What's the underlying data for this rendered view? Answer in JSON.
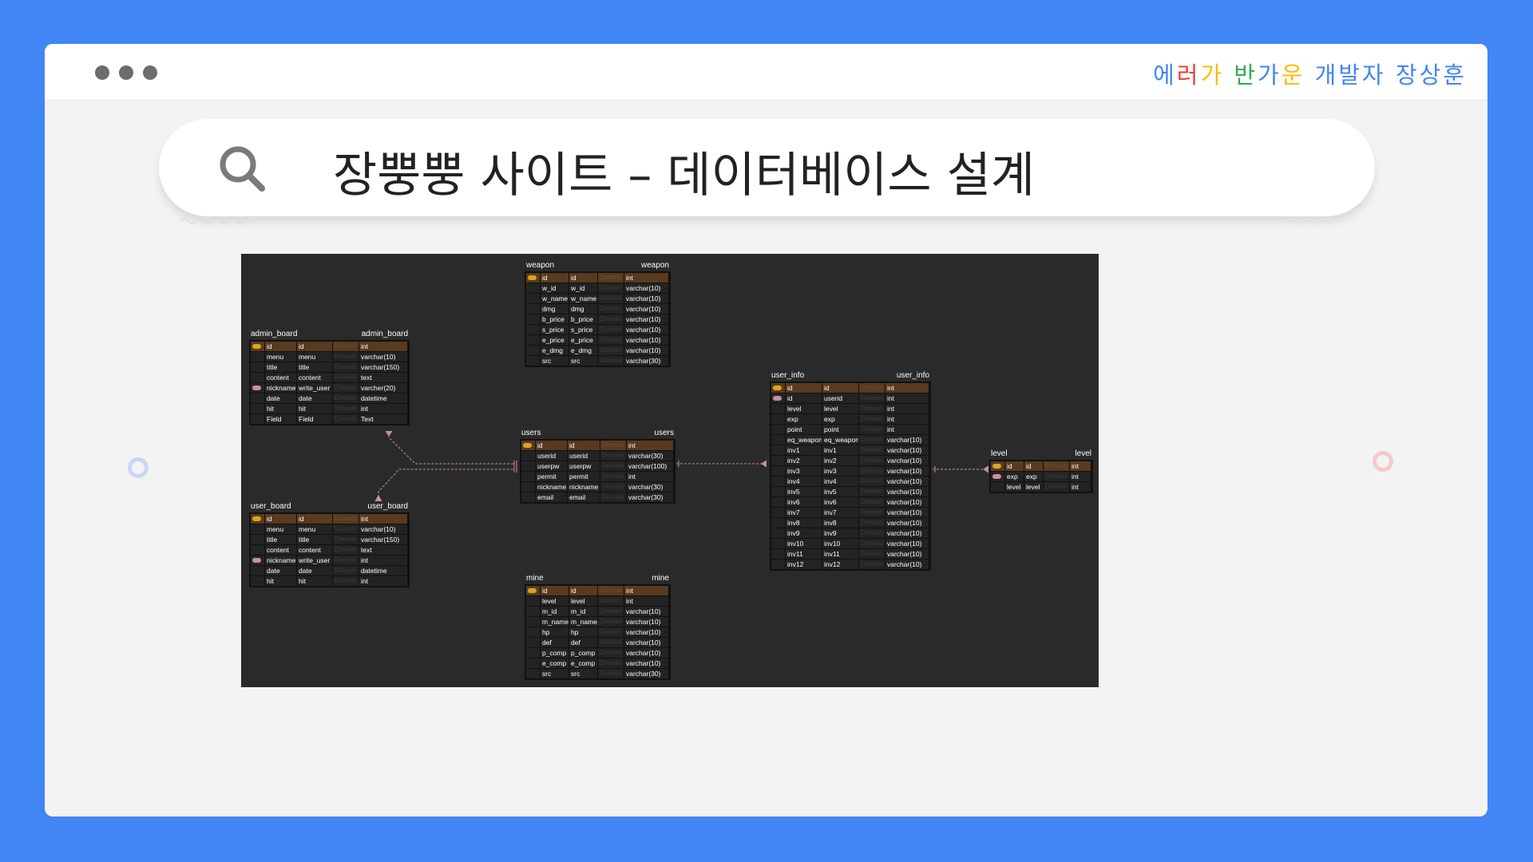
{
  "window": {
    "brand_chars": [
      {
        "ch": "에",
        "color": "#4285f4"
      },
      {
        "ch": "러",
        "color": "#ea4335"
      },
      {
        "ch": "가",
        "color": "#fbbc05"
      },
      {
        "ch": " ",
        "color": "#000000"
      },
      {
        "ch": "반",
        "color": "#34a853"
      },
      {
        "ch": "가",
        "color": "#4285f4"
      },
      {
        "ch": "운",
        "color": "#fbbc05"
      },
      {
        "ch": " ",
        "color": "#000000"
      },
      {
        "ch": "개",
        "color": "#4285f4"
      },
      {
        "ch": "발",
        "color": "#4285f4"
      },
      {
        "ch": "자",
        "color": "#4285f4"
      },
      {
        "ch": " ",
        "color": "#000000"
      },
      {
        "ch": "장",
        "color": "#4285f4"
      },
      {
        "ch": "상",
        "color": "#4285f4"
      },
      {
        "ch": "훈",
        "color": "#4285f4"
      }
    ]
  },
  "search": {
    "title": "장뿡뿡 사이트 – 데이터베이스 설계",
    "icon": "search-icon"
  },
  "tables": {
    "weapon": {
      "left": "weapon",
      "right": "weapon",
      "rows": [
        [
          "pk",
          "id",
          "id",
          "Domain",
          "int"
        ],
        [
          "",
          "w_id",
          "w_id",
          "Domain",
          "varchar(10)"
        ],
        [
          "",
          "w_name",
          "w_name",
          "Domain",
          "varchar(10)"
        ],
        [
          "",
          "dmg",
          "dmg",
          "Domain",
          "varchar(10)"
        ],
        [
          "",
          "b_price",
          "b_price",
          "Domain",
          "varchar(10)"
        ],
        [
          "",
          "s_price",
          "s_price",
          "Domain",
          "varchar(10)"
        ],
        [
          "",
          "e_price",
          "e_price",
          "Domain",
          "varchar(10)"
        ],
        [
          "",
          "e_dmg",
          "e_dmg",
          "Domain",
          "varchar(10)"
        ],
        [
          "",
          "src",
          "src",
          "Domain",
          "varchar(30)"
        ]
      ]
    },
    "admin_board": {
      "left": "admin_board",
      "right": "admin_board",
      "rows": [
        [
          "pk",
          "id",
          "id",
          "Domain",
          "int"
        ],
        [
          "",
          "menu",
          "menu",
          "Domain",
          "varchar(10)"
        ],
        [
          "",
          "title",
          "title",
          "Domain",
          "varchar(150)"
        ],
        [
          "",
          "content",
          "content",
          "Domain",
          "text"
        ],
        [
          "fk",
          "nickname",
          "write_user",
          "Domain",
          "varcher(20)"
        ],
        [
          "",
          "date",
          "date",
          "Domain",
          "datetime"
        ],
        [
          "",
          "hit",
          "hit",
          "Domain",
          "int"
        ],
        [
          "",
          "Field",
          "Field",
          "Domain",
          "Text"
        ]
      ]
    },
    "user_board": {
      "left": "user_board",
      "right": "user_board",
      "rows": [
        [
          "pk",
          "id",
          "id",
          "Domain",
          "int"
        ],
        [
          "",
          "menu",
          "menu",
          "Domain",
          "varchar(10)"
        ],
        [
          "",
          "title",
          "title",
          "Domain",
          "varchar(150)"
        ],
        [
          "",
          "content",
          "content",
          "Domain",
          "text"
        ],
        [
          "fk",
          "nickname",
          "write_user",
          "Domain",
          "int"
        ],
        [
          "",
          "date",
          "date",
          "Domain",
          "datetime"
        ],
        [
          "",
          "hit",
          "hit",
          "Domain",
          "int"
        ]
      ]
    },
    "users": {
      "left": "users",
      "right": "users",
      "rows": [
        [
          "pk",
          "id",
          "id",
          "Domain",
          "int"
        ],
        [
          "",
          "userid",
          "userid",
          "Domain",
          "varchar(30)"
        ],
        [
          "",
          "userpw",
          "userpw",
          "Domain",
          "varchar(100)"
        ],
        [
          "",
          "permit",
          "permit",
          "Domain",
          "int"
        ],
        [
          "",
          "nickname",
          "nickname",
          "Domain",
          "varchar(30)"
        ],
        [
          "",
          "email",
          "email",
          "Domain",
          "varchar(30)"
        ]
      ]
    },
    "mine": {
      "left": "mine",
      "right": "mine",
      "rows": [
        [
          "pk",
          "id",
          "id",
          "Domain",
          "int"
        ],
        [
          "",
          "level",
          "level",
          "Domain",
          "int"
        ],
        [
          "",
          "m_id",
          "m_id",
          "Domain",
          "varchar(10)"
        ],
        [
          "",
          "m_name",
          "m_name",
          "Domain",
          "varchar(10)"
        ],
        [
          "",
          "hp",
          "hp",
          "Domain",
          "varchar(10)"
        ],
        [
          "",
          "def",
          "def",
          "Domain",
          "varchar(10)"
        ],
        [
          "",
          "p_comp",
          "p_comp",
          "Domain",
          "varchar(10)"
        ],
        [
          "",
          "e_comp",
          "e_comp",
          "Domain",
          "varchar(10)"
        ],
        [
          "",
          "src",
          "src",
          "Domain",
          "varchar(30)"
        ]
      ]
    },
    "user_info": {
      "left": "user_info",
      "right": "user_info",
      "rows": [
        [
          "pk",
          "id",
          "id",
          "Domain",
          "int"
        ],
        [
          "fk",
          "id",
          "userid",
          "Domain",
          "int"
        ],
        [
          "",
          "level",
          "level",
          "Domain",
          "int"
        ],
        [
          "",
          "exp",
          "exp",
          "Domain",
          "int"
        ],
        [
          "",
          "point",
          "point",
          "Domain",
          "int"
        ],
        [
          "",
          "eq_weapon",
          "eq_weapon",
          "Domain",
          "varchar(10)"
        ],
        [
          "",
          "inv1",
          "inv1",
          "Domain",
          "varchar(10)"
        ],
        [
          "",
          "inv2",
          "inv2",
          "Domain",
          "varchar(10)"
        ],
        [
          "",
          "inv3",
          "inv3",
          "Domain",
          "varchar(10)"
        ],
        [
          "",
          "inv4",
          "inv4",
          "Domain",
          "varchar(10)"
        ],
        [
          "",
          "inv5",
          "inv5",
          "Domain",
          "varchar(10)"
        ],
        [
          "",
          "inv6",
          "inv6",
          "Domain",
          "varchar(10)"
        ],
        [
          "",
          "inv7",
          "inv7",
          "Domain",
          "varchar(10)"
        ],
        [
          "",
          "inv8",
          "inv8",
          "Domain",
          "varchar(10)"
        ],
        [
          "",
          "inv9",
          "inv9",
          "Domain",
          "varchar(10)"
        ],
        [
          "",
          "inv10",
          "inv10",
          "Domain",
          "varchar(10)"
        ],
        [
          "",
          "inv11",
          "inv11",
          "Domain",
          "varchar(10)"
        ],
        [
          "",
          "inv12",
          "inv12",
          "Domain",
          "varchar(10)"
        ]
      ]
    },
    "level": {
      "left": "level",
      "right": "level",
      "rows": [
        [
          "pk",
          "id",
          "id",
          "Domain",
          "int"
        ],
        [
          "fk",
          "exp",
          "exp",
          "Domain",
          "int"
        ],
        [
          "",
          "level",
          "level",
          "Domain",
          "int"
        ]
      ]
    }
  },
  "colors": {
    "background": "#4285f4",
    "pk_key": "#d9a520",
    "fk_key": "#c98ea2",
    "relation_line": "#c98ea2"
  }
}
